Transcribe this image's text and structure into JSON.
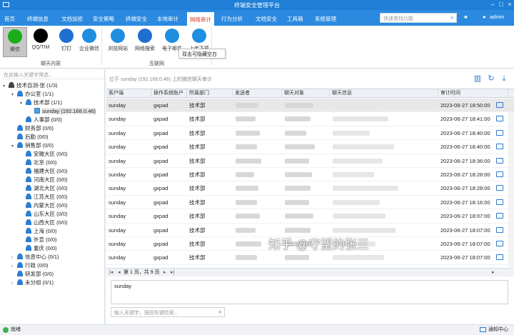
{
  "window": {
    "title": "终端安全管理平台"
  },
  "menu": {
    "tabs": [
      {
        "label": "首页"
      },
      {
        "label": "终端信息"
      },
      {
        "label": "文档加密"
      },
      {
        "label": "安全策略"
      },
      {
        "label": "终端安全"
      },
      {
        "label": "本地审计"
      },
      {
        "label": "网络审计"
      },
      {
        "label": "行为分析"
      },
      {
        "label": "文档安全"
      },
      {
        "label": "工具箱"
      },
      {
        "label": "系统管理"
      }
    ],
    "active_tab": "网络审计",
    "search_placeholder": "快速查找功能",
    "user": "admin"
  },
  "ribbon": {
    "chat_group": {
      "label": "聊天内容",
      "items": [
        {
          "label": "微信",
          "active": true
        },
        {
          "label": "QQ/TIM"
        },
        {
          "label": "钉钉"
        },
        {
          "label": "企业微信"
        }
      ]
    },
    "web_group": {
      "label": "互联网",
      "items": [
        {
          "label": "浏览网站"
        },
        {
          "label": "网络搜索"
        },
        {
          "label": "电子邮件"
        },
        {
          "label": "上传下载"
        }
      ]
    },
    "tooltip": "双击可隐藏空白"
  },
  "tree": {
    "filter_placeholder": "在此输入关键字筛选...",
    "nodes": [
      {
        "label": "技术自测-张 (1/3)",
        "toggle": "▾",
        "icon": "dark"
      },
      {
        "label": "办公室 (1/1)",
        "toggle": "▾",
        "icon": "blue"
      },
      {
        "label": "技术部 (1/1)",
        "toggle": "▾",
        "icon": "blue"
      },
      {
        "label": "sunday (192.168.0.46)",
        "toggle": "",
        "icon": "monitor",
        "selected": true
      },
      {
        "label": "人事部 (0/0)",
        "toggle": "",
        "icon": "blue"
      },
      {
        "label": "财务部 (0/0)",
        "toggle": "",
        "icon": "blue"
      },
      {
        "label": "后勤 (0/0)",
        "toggle": "",
        "icon": "blue"
      },
      {
        "label": "销售部 (0/0)",
        "toggle": "▾",
        "icon": "blue"
      },
      {
        "label": "安徽大区 (0/0)",
        "toggle": "",
        "icon": "blue"
      },
      {
        "label": "北京 (0/0)",
        "toggle": "",
        "icon": "blue"
      },
      {
        "label": "福建大区 (0/0)",
        "toggle": "",
        "icon": "blue"
      },
      {
        "label": "河南大区 (0/0)",
        "toggle": "",
        "icon": "blue"
      },
      {
        "label": "湖北大区 (0/0)",
        "toggle": "",
        "icon": "blue"
      },
      {
        "label": "江苏大区 (0/0)",
        "toggle": "",
        "icon": "blue"
      },
      {
        "label": "内蒙大区 (0/0)",
        "toggle": "",
        "icon": "blue"
      },
      {
        "label": "山东大区 (0/0)",
        "toggle": "",
        "icon": "blue"
      },
      {
        "label": "山西大区 (0/0)",
        "toggle": "",
        "icon": "blue"
      },
      {
        "label": "上海 (0/0)",
        "toggle": "",
        "icon": "blue"
      },
      {
        "label": "外宣 (0/0)",
        "toggle": "",
        "icon": "blue"
      },
      {
        "label": "重庆 (0/0)",
        "toggle": "",
        "icon": "blue"
      },
      {
        "label": "信息中心 (0/1)",
        "toggle": "›",
        "icon": "blue"
      },
      {
        "label": "行政 (0/0)",
        "toggle": "›",
        "icon": "blue"
      },
      {
        "label": "研发部 (0/0)",
        "toggle": "",
        "icon": "blue"
      },
      {
        "label": "未分组 (0/1)",
        "toggle": "›",
        "icon": "blue"
      }
    ]
  },
  "main": {
    "hint": "位于 sunday (192.168.0.46) 上的微信聊天审计",
    "columns": [
      "客户端",
      "操作系统账户",
      "所属部门",
      "发送者",
      "聊天对象",
      "聊天信息",
      "审计时间"
    ],
    "rows": [
      {
        "client": "sunday",
        "account": "gxpad",
        "dept": "技术部",
        "time": "2023-06-27 18:50:00"
      },
      {
        "client": "sunday",
        "account": "gxpad",
        "dept": "技术部",
        "time": "2023-06-27 18:41:00"
      },
      {
        "client": "sunday",
        "account": "gxpad",
        "dept": "技术部",
        "time": "2023-06-27 18:40:00"
      },
      {
        "client": "sunday",
        "account": "gxpad",
        "dept": "技术部",
        "time": "2023-06-27 18:40:00"
      },
      {
        "client": "sunday",
        "account": "gxpad",
        "dept": "技术部",
        "time": "2023-06-27 18:36:00"
      },
      {
        "client": "sunday",
        "account": "gxpad",
        "dept": "技术部",
        "time": "2023-06-27 18:28:00"
      },
      {
        "client": "sunday",
        "account": "gxpad",
        "dept": "技术部",
        "time": "2023-06-27 18:28:00"
      },
      {
        "client": "sunday",
        "account": "gxpad",
        "dept": "技术部",
        "time": "2023-06-27 18:16:00"
      },
      {
        "client": "sunday",
        "account": "gxpad",
        "dept": "技术部",
        "time": "2023-06-27 18:07:00"
      },
      {
        "client": "sunday",
        "account": "gxpad",
        "dept": "技术部",
        "time": "2023-06-27 18:07:00"
      },
      {
        "client": "sunday",
        "account": "gxpad",
        "dept": "技术部",
        "time": "2023-06-27 18:07:00"
      },
      {
        "client": "sunday",
        "account": "gxpad",
        "dept": "技术部",
        "time": "2023-06-27 18:07:00"
      },
      {
        "client": "sunday",
        "account": "gxpad",
        "dept": "技术部",
        "time": "2023-06-27 18:07:00"
      }
    ],
    "pager": "第 1 页，共 9 页",
    "detail_text": "sunday",
    "search_placeholder": "输入关键字，按回车键检索..."
  },
  "watermark": "知乎 @守望的张三",
  "status": {
    "left": "就绪",
    "right": "通知中心"
  }
}
